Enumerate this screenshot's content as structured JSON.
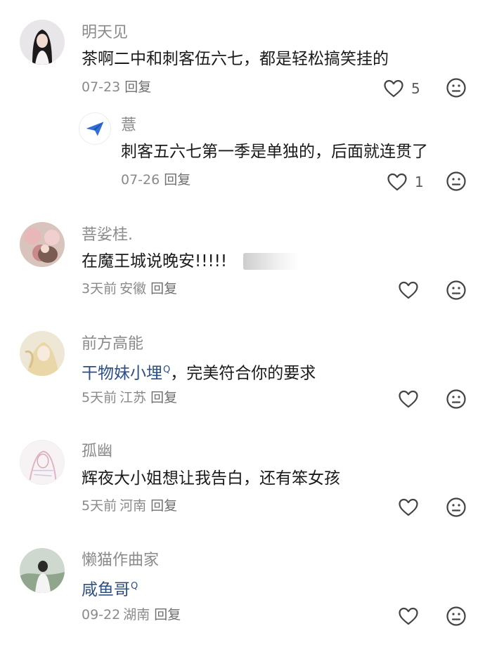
{
  "comments": [
    {
      "username": "明天见",
      "text": "茶啊二中和刺客伍六七，都是轻松搞笑挂的",
      "date": "07-23",
      "location": "",
      "reply_label": "回复",
      "likes": "5",
      "replies": [
        {
          "username": "薏",
          "text": "刺客五六七第一季是单独的，后面就连贯了",
          "date": "07-26",
          "reply_label": "回复",
          "likes": "1"
        }
      ]
    },
    {
      "username": "菩娑桂.",
      "text": "在魔王城说晚安!!!!!",
      "date": "3天前",
      "location": "安徽",
      "reply_label": "回复",
      "likes": ""
    },
    {
      "username": "前方高能",
      "mention": "干物妹小埋",
      "mention_mark": "Q",
      "text": "，完美符合你的要求",
      "date": "5天前",
      "location": "江苏",
      "reply_label": "回复",
      "likes": ""
    },
    {
      "username": "孤幽",
      "text": "辉夜大小姐想让我告白，还有笨女孩",
      "date": "5天前",
      "location": "河南",
      "reply_label": "回复",
      "likes": ""
    },
    {
      "username": "懒猫作曲家",
      "mention": "咸鱼哥",
      "mention_mark": "Q",
      "text": "",
      "date": "09-22",
      "location": "湖南",
      "reply_label": "回复",
      "likes": ""
    }
  ],
  "icons": {
    "like": "heart-outline-icon",
    "reaction": "neutral-face-icon",
    "reply_avatar": "paper-plane-icon"
  },
  "colors": {
    "text": "#1a1a1a",
    "secondary": "#8a8a8a",
    "mention": "#2b4f86",
    "icon_stroke": "#444444",
    "plane": "#2f6fd6"
  }
}
